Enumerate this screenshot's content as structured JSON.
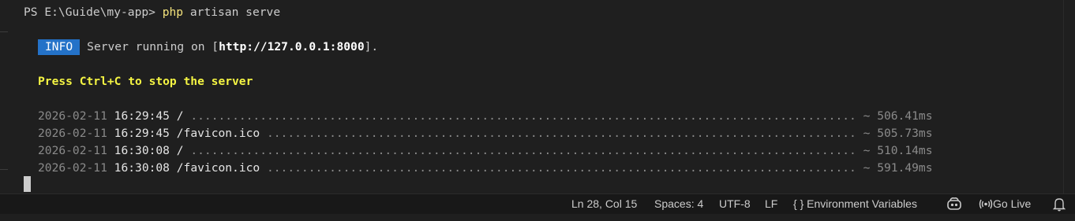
{
  "terminal": {
    "prompt": "PS E:\\Guide\\my-app> ",
    "command_php": "php",
    "command_rest": " artisan serve",
    "info_badge": "INFO",
    "server_text_pre": "Server running on [",
    "server_url": "http://127.0.0.1:8000",
    "server_text_post": "].",
    "stop_hint": "Press Ctrl+C to stop the server",
    "requests": [
      {
        "date": "2026-02-11",
        "time": "16:29:45",
        "path": "/",
        "dots": " ................................................................................................ ~ ",
        "duration": "506.41ms"
      },
      {
        "date": "2026-02-11",
        "time": "16:29:45",
        "path": "/favicon.ico",
        "dots": " ..................................................................................... ~ ",
        "duration": "505.73ms"
      },
      {
        "date": "2026-02-11",
        "time": "16:30:08",
        "path": "/",
        "dots": " ................................................................................................ ~ ",
        "duration": "510.14ms"
      },
      {
        "date": "2026-02-11",
        "time": "16:30:08",
        "path": "/favicon.ico",
        "dots": " ..................................................................................... ~ ",
        "duration": "591.49ms"
      }
    ]
  },
  "statusbar": {
    "cursor_position": "Ln 28, Col 15",
    "spaces": "Spaces: 4",
    "encoding": "UTF-8",
    "eol": "LF",
    "braces_glyph": "{ }",
    "env_vars": "Environment Variables",
    "copilot_icon": "copilot-icon",
    "go_live_icon": "broadcast-icon",
    "go_live": "Go Live",
    "bell_icon": "bell-icon"
  }
}
